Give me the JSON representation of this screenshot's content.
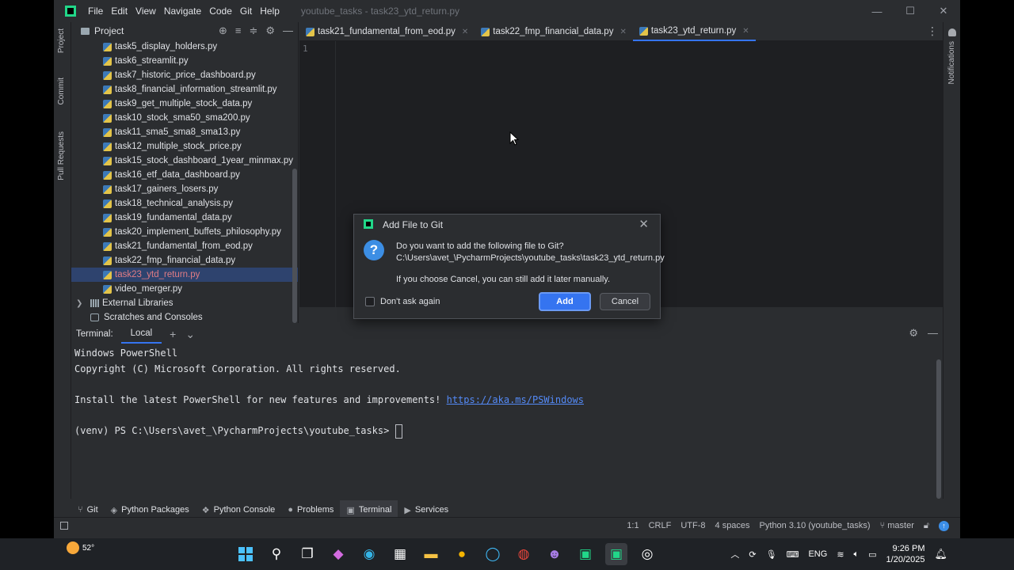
{
  "window": {
    "title": "youtube_tasks - task23_ytd_return.py",
    "menu": [
      "File",
      "Edit",
      "View",
      "Navigate",
      "Code",
      "Git",
      "Help"
    ],
    "controls": [
      "—",
      "☐",
      "✕"
    ]
  },
  "left_strip": {
    "project": "Project",
    "commit": "Commit",
    "pull_requests": "Pull Requests"
  },
  "right_strip": {
    "notifications": "Notifications"
  },
  "project_panel": {
    "title": "Project",
    "files": [
      "task5_display_holders.py",
      "task6_streamlit.py",
      "task7_historic_price_dashboard.py",
      "task8_financial_information_streamlit.py",
      "task9_get_multiple_stock_data.py",
      "task10_stock_sma50_sma200.py",
      "task11_sma5_sma8_sma13.py",
      "task12_multiple_stock_price.py",
      "task15_stock_dashboard_1year_minmax.py",
      "task16_etf_data_dashboard.py",
      "task17_gainers_losers.py",
      "task18_technical_analysis.py",
      "task19_fundamental_data.py",
      "task20_implement_buffets_philosophy.py",
      "task21_fundamental_from_eod.py",
      "task22_fmp_financial_data.py",
      "task23_ytd_return.py",
      "video_merger.py"
    ],
    "selected_index": 16,
    "external_libraries": "External Libraries",
    "scratches": "Scratches and Consoles"
  },
  "editor": {
    "tabs": [
      {
        "label": "task21_fundamental_from_eod.py",
        "active": false
      },
      {
        "label": "task22_fmp_financial_data.py",
        "active": false
      },
      {
        "label": "task23_ytd_return.py",
        "active": true
      }
    ],
    "line_number": "1"
  },
  "dialog": {
    "title": "Add File to Git",
    "question": "Do you want to add the following file to Git?",
    "path": "C:\\Users\\avet_\\PycharmProjects\\youtube_tasks\\task23_ytd_return.py",
    "note": "If you choose Cancel, you can still add it later manually.",
    "checkbox_label": "Don't ask again",
    "add_label": "Add",
    "cancel_label": "Cancel"
  },
  "terminal": {
    "label": "Terminal:",
    "tab": "Local",
    "lines": {
      "l1": "Windows PowerShell",
      "l2": "Copyright (C) Microsoft Corporation. All rights reserved.",
      "l4_text": "Install the latest PowerShell for new features and improvements! ",
      "l4_link": "https://aka.ms/PSWindows",
      "l6": "(venv) PS C:\\Users\\avet_\\PycharmProjects\\youtube_tasks> "
    }
  },
  "tool_windows": [
    "Git",
    "Python Packages",
    "Python Console",
    "Problems",
    "Terminal",
    "Services"
  ],
  "status_bar": {
    "position": "1:1",
    "line_sep": "CRLF",
    "encoding": "UTF-8",
    "indent": "4 spaces",
    "interpreter": "Python 3.10 (youtube_tasks)",
    "branch": "master"
  },
  "taskbar": {
    "temperature": "52°",
    "language": "ENG",
    "time": "9:26 PM",
    "date": "1/20/2025"
  },
  "colors": {
    "accent": "#3574f0",
    "selected_row": "#2e436e",
    "selected_text": "#e07c84",
    "link": "#548af7"
  }
}
